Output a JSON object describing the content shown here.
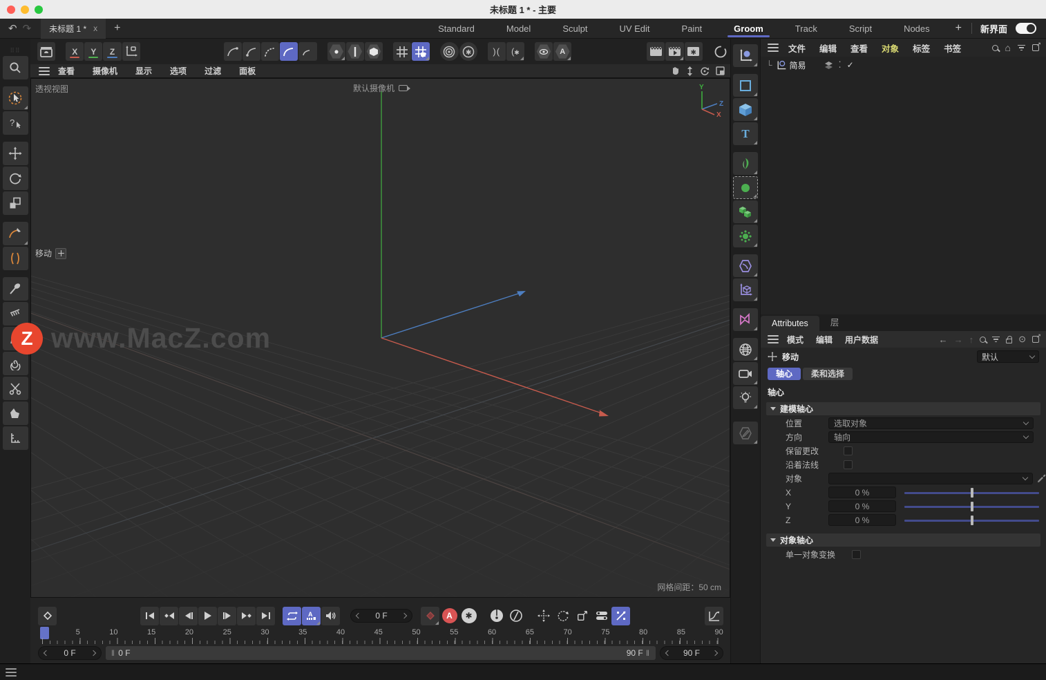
{
  "colors": {
    "accent": "#5e69c3",
    "axis_x_red": "#c75b4d",
    "axis_y_green": "#3f9e3f",
    "axis_z_blue": "#4d7ec0",
    "autokey_red": "#d95454",
    "menu_highlight_yellow": "#d8d872",
    "watermark_orange": "#e8462e"
  },
  "titlebar": {
    "title": "未标题 1 * - 主要"
  },
  "menubar": {
    "doc_tab": "未标题 1 *",
    "close": "x",
    "add_tab": "+",
    "workspaces": [
      "Standard",
      "Model",
      "Sculpt",
      "UV Edit",
      "Paint",
      "Groom",
      "Track",
      "Script",
      "Nodes"
    ],
    "active_workspace": "Groom",
    "add_workspace": "+",
    "new_ui": "新界面"
  },
  "toolbar": {
    "axis_x": "X",
    "axis_y": "Y",
    "axis_z": "Z"
  },
  "viewport_menu": {
    "items": [
      "查看",
      "摄像机",
      "显示",
      "选项",
      "过滤",
      "面板"
    ]
  },
  "viewport": {
    "view_label": "透视视图",
    "camera_label": "默认摄像机",
    "tool_hint": "移动",
    "grid_spacing": "网格间距：50 cm",
    "gizmo": {
      "x": "X",
      "y": "Y",
      "z": "Z"
    }
  },
  "watermark": {
    "badge": "Z",
    "text": "www.MacZ.com"
  },
  "object_manager": {
    "menu": [
      "文件",
      "编辑",
      "查看",
      "对象",
      "标签",
      "书签"
    ],
    "active_menu": "对象",
    "object_name": "简易"
  },
  "attributes": {
    "tab_attributes": "Attributes",
    "tab_layers": "层",
    "menu": [
      "模式",
      "编辑",
      "用户数据"
    ],
    "tool_label": "移动",
    "preset": "默认",
    "subtab_axis": "轴心",
    "subtab_soft": "柔和选择",
    "section": "轴心",
    "modeling_axis": {
      "title": "建模轴心",
      "position_label": "位置",
      "position_value": "选取对象",
      "orientation_label": "方向",
      "orientation_value": "轴向",
      "keep_changes_label": "保留更改",
      "along_normal_label": "沿着法线",
      "object_label": "对象",
      "sliders": [
        {
          "label": "X",
          "value": "0 %"
        },
        {
          "label": "Y",
          "value": "0 %"
        },
        {
          "label": "Z",
          "value": "0 %"
        }
      ]
    },
    "object_axis": {
      "title": "对象轴心",
      "single_transform_label": "单一对象变换"
    }
  },
  "timeline": {
    "current_frame": "0 F",
    "range_start": "0 F",
    "range_end": "90 F",
    "end_frame": "90 F",
    "ruler_labels": [
      "0",
      "5",
      "10",
      "15",
      "20",
      "25",
      "30",
      "35",
      "40",
      "45",
      "50",
      "55",
      "60",
      "65",
      "70",
      "75",
      "80",
      "85",
      "90"
    ]
  }
}
